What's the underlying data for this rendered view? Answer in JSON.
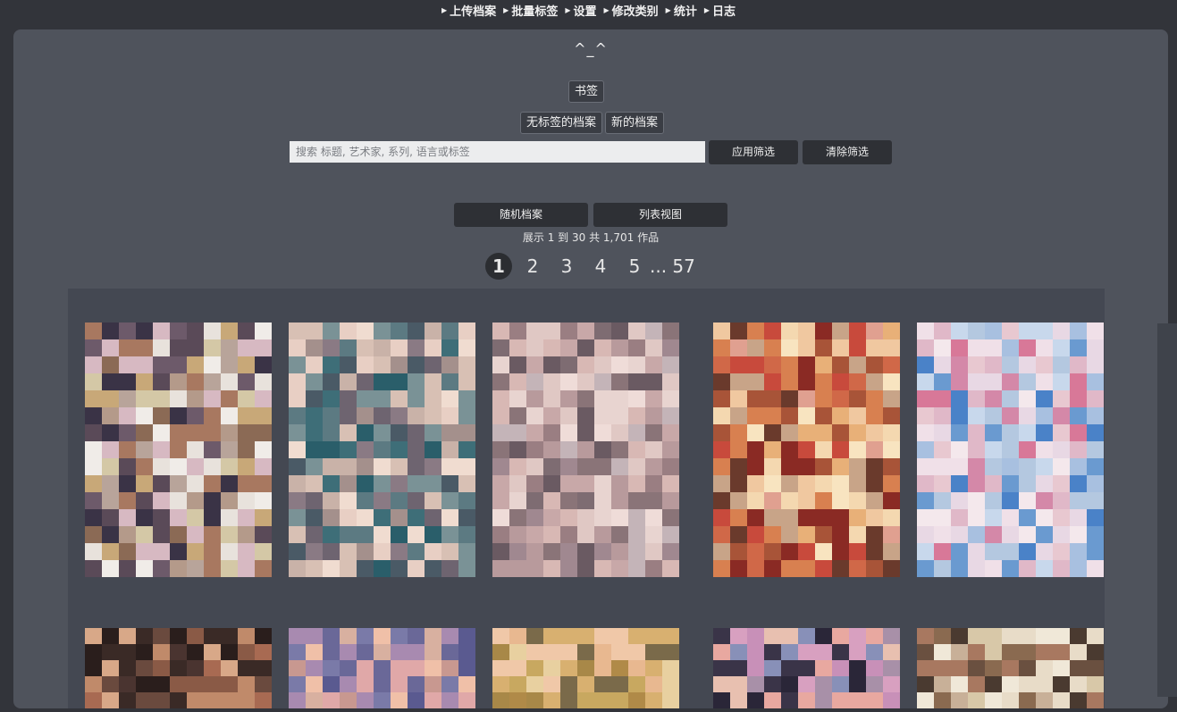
{
  "nav": {
    "items": [
      {
        "label": "上传档案"
      },
      {
        "label": "批量标签"
      },
      {
        "label": "设置"
      },
      {
        "label": "修改类别"
      },
      {
        "label": "统计"
      },
      {
        "label": "日志"
      }
    ]
  },
  "header": {
    "logo": "^_^",
    "bookmark_label": "书签",
    "untagged_label": "无标签的档案",
    "new_label": "新的档案"
  },
  "search": {
    "placeholder": "搜索 标题, 艺术家, 系列, 语言或标签",
    "value": "",
    "apply_label": "应用筛选",
    "clear_label": "清除筛选"
  },
  "actions": {
    "random_label": "随机档案",
    "list_view_label": "列表视图"
  },
  "results": {
    "summary": "展示 1 到 30 共 1,701 作品"
  },
  "pagination": {
    "current": "1",
    "pages": [
      "1",
      "2",
      "3",
      "4",
      "5"
    ],
    "ellipsis": "...",
    "last": "57"
  },
  "thumbnails": {
    "row1": [
      {
        "palette": [
          "#e8e2dc",
          "#d7b9c2",
          "#b49a8a",
          "#5a4a58",
          "#c8a878",
          "#8b6a55",
          "#3a3346",
          "#d4c8a6",
          "#a87860",
          "#f0ece8",
          "#6d5a6a",
          "#b8a49a"
        ]
      },
      {
        "palette": [
          "#7a9296",
          "#3e6e78",
          "#2a5e6a",
          "#c9b2a8",
          "#e8cfc4",
          "#8a7a84",
          "#5c7a82",
          "#d8c0b4",
          "#4a5a66",
          "#a4908c",
          "#f0dcd0",
          "#6e6470"
        ]
      },
      {
        "palette": [
          "#8a7478",
          "#c8a8a8",
          "#e0c8c4",
          "#6a5a62",
          "#b89a9c",
          "#d8b8b4",
          "#a08890",
          "#efdcd8",
          "#9a7e82",
          "#c4b4b8",
          "#7e6c72",
          "#e8d4d0"
        ]
      },
      {
        "palette": [
          "#e0a090",
          "#c84a3c",
          "#8a2a24",
          "#f0c8a0",
          "#d88050",
          "#f4d8b0",
          "#a85438",
          "#e8b078",
          "#f8e4c0",
          "#6a3a2c",
          "#d06848",
          "#c8a488"
        ]
      },
      {
        "palette": [
          "#e8d8e4",
          "#d488a8",
          "#f0e0e8",
          "#a8c0e0",
          "#6a9ad0",
          "#e8c8d0",
          "#c8d8ec",
          "#d87898",
          "#f4e8ec",
          "#4a82c8",
          "#e0b8c8",
          "#b4c8e0"
        ]
      }
    ],
    "row2": [
      {
        "palette": [
          "#3a2a26",
          "#6a4a3e",
          "#c08a6a",
          "#a86a52",
          "#2a1e1c",
          "#d8a888",
          "#8a5a46",
          "#4a3430"
        ]
      },
      {
        "palette": [
          "#7a7aa8",
          "#5a5a90",
          "#e0a8a8",
          "#c89890",
          "#a88ab0",
          "#f0c0a8",
          "#6a6898",
          "#d8b0a0"
        ]
      },
      {
        "palette": [
          "#c8a860",
          "#b08a48",
          "#e8d0a0",
          "#f0c8a8",
          "#a88848",
          "#e8b890",
          "#d8b070",
          "#7a6a4a"
        ]
      },
      {
        "palette": [
          "#e8a8a0",
          "#c890b8",
          "#3a3448",
          "#a890a8",
          "#e8c0b0",
          "#2a2638",
          "#d8a0c0",
          "#8890b8"
        ]
      },
      {
        "palette": [
          "#e8dcc8",
          "#a87860",
          "#4a3a30",
          "#d8c8a8",
          "#6a5040",
          "#f0e8d8",
          "#8a6a50",
          "#c8b098"
        ]
      }
    ]
  }
}
